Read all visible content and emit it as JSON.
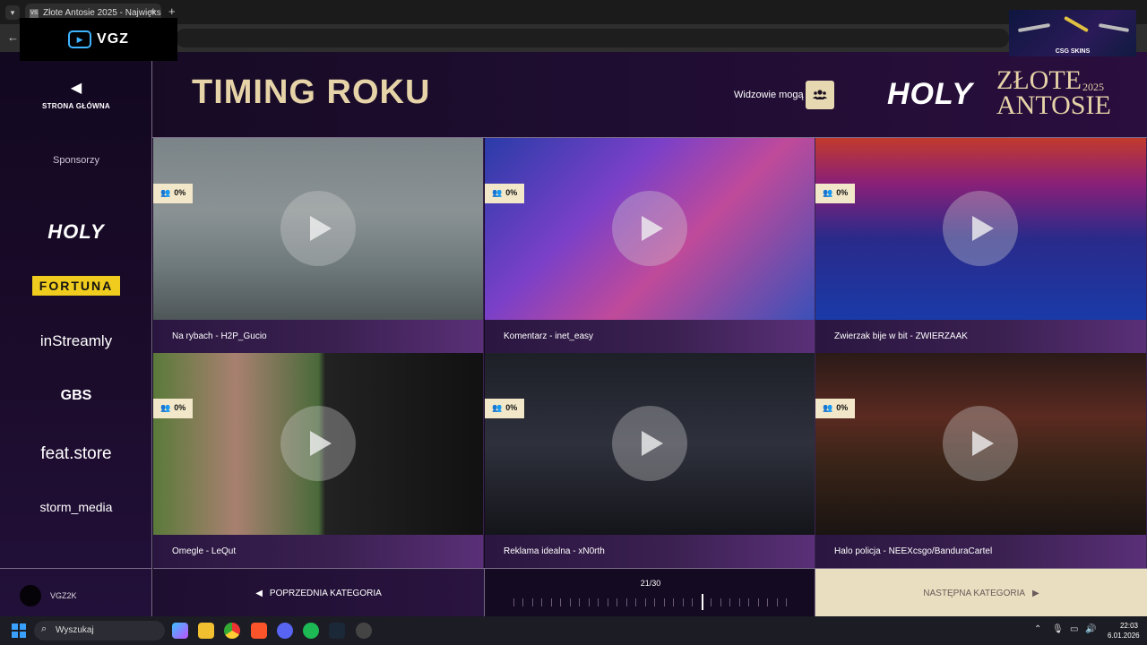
{
  "browser": {
    "tab_title": "Złote Antosie 2025 - Największ",
    "tab_favicon": "VS",
    "close": "×",
    "new_tab": "+"
  },
  "overlays": {
    "vgz": "VGZ",
    "csg": "CSG SKINS"
  },
  "sidebar": {
    "home_label": "STRONA GŁÓWNA",
    "sponsors_title": "Sponsorzy",
    "sponsors": [
      "HOLY",
      "FORTUNA",
      "inStreamly",
      "GBS",
      "feat.store",
      "storm_media"
    ],
    "username": "VGZ2K"
  },
  "header": {
    "title": "TIMING ROKU",
    "viewers_label": "Widzowie mogą",
    "brand_holy": "HOLY",
    "brand_line1": "ZŁOTE",
    "brand_line2": "ANTOSIE",
    "brand_year": "2025"
  },
  "tiles": [
    {
      "caption": "Na rybach - H2P_Gucio",
      "percent": "0%"
    },
    {
      "caption": "Komentarz - inet_easy",
      "percent": "0%"
    },
    {
      "caption": "Zwierzak bije w bit - ZWIERZAAK",
      "percent": "0%"
    },
    {
      "caption": "Omegle - LeQut",
      "percent": "0%"
    },
    {
      "caption": "Reklama idealna - xN0rth",
      "percent": "0%"
    },
    {
      "caption": "Halo policja - NEEXcsgo/BanduraCartel",
      "percent": "0%"
    }
  ],
  "nav": {
    "prev_label": "POPRZEDNIA KATEGORIA",
    "next_label": "NASTĘPNA KATEGORIA",
    "progress_label": "21/30",
    "current": 21,
    "total": 30
  },
  "taskbar": {
    "search_label": "Wyszukaj",
    "time": "22:03",
    "date": "6.01.2026"
  },
  "colors": {
    "gold": "#e6d3a8",
    "badge": "#f2e7c8",
    "next_bg": "#e9dfc0",
    "bg": "#150a22"
  }
}
